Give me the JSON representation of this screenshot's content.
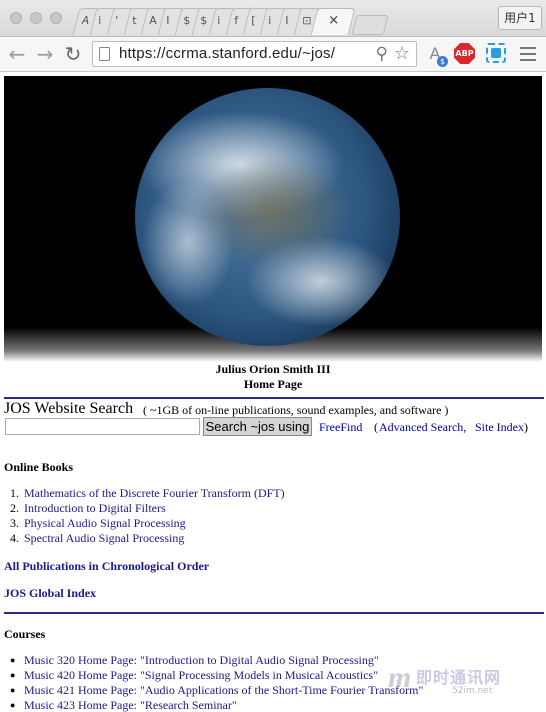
{
  "browser": {
    "tab_glyphs": [
      "𝐴",
      "i",
      "'",
      "t",
      "A",
      "I",
      "$",
      "$",
      "i",
      "f",
      "[",
      "i",
      "I",
      "⊡"
    ],
    "active_tab_close": "×",
    "user_button": "用户1",
    "url": "https://ccrma.stanford.edu/~jos/",
    "icons": {
      "back": "back-arrow-icon",
      "forward": "forward-arrow-icon",
      "reload": "reload-icon",
      "page": "page-icon",
      "search": "magnifier-icon",
      "bookmark": "star-icon",
      "translate": "translate-icon",
      "adblock": "abp-icon",
      "screenshot": "camera-icon",
      "menu": "hamburger-menu-icon"
    },
    "glyphs": {
      "back": "←",
      "forward": "→",
      "reload": "↻",
      "search": "⚲",
      "bookmark": "☆",
      "translate": "A",
      "translate_badge": "$",
      "adblock": "ABP"
    }
  },
  "page": {
    "caption_name": "Julius Orion Smith III",
    "caption_sub": "Home Page",
    "search": {
      "title": "JOS Website Search",
      "note": "( ~1GB of on-line publications, sound examples, and software )",
      "input_value": "",
      "button": "Search ~jos using",
      "freefind": "FreeFind",
      "open_paren": "(",
      "advanced": "Advanced Search,",
      "site_index": "Site Index",
      "close_paren": ")"
    },
    "online_books": {
      "heading": "Online Books",
      "items": [
        {
          "num": "1.",
          "label": "Mathematics of the Discrete Fourier Transform (DFT)"
        },
        {
          "num": "2.",
          "label": "Introduction to Digital Filters"
        },
        {
          "num": "3.",
          "label": "Physical Audio Signal Processing"
        },
        {
          "num": "4.",
          "label": "Spectral Audio Signal Processing"
        }
      ]
    },
    "all_publications": "All Publications in Chronological Order",
    "global_index": "JOS Global Index",
    "courses": {
      "heading": "Courses",
      "items": [
        {
          "label": "Music 320 Home Page: \"Introduction to Digital Audio Signal Processing\""
        },
        {
          "label": "Music 420 Home Page: \"Signal Processing Models in Musical Acoustics\""
        },
        {
          "label": "Music 421 Home Page: \"Audio Applications of the Short-Time Fourier Transform\""
        },
        {
          "label": "Music 423 Home Page: \"Research Seminar\""
        }
      ]
    },
    "watermark": {
      "logo": "m",
      "text": "即时通讯网",
      "sub": "52im.net"
    }
  }
}
